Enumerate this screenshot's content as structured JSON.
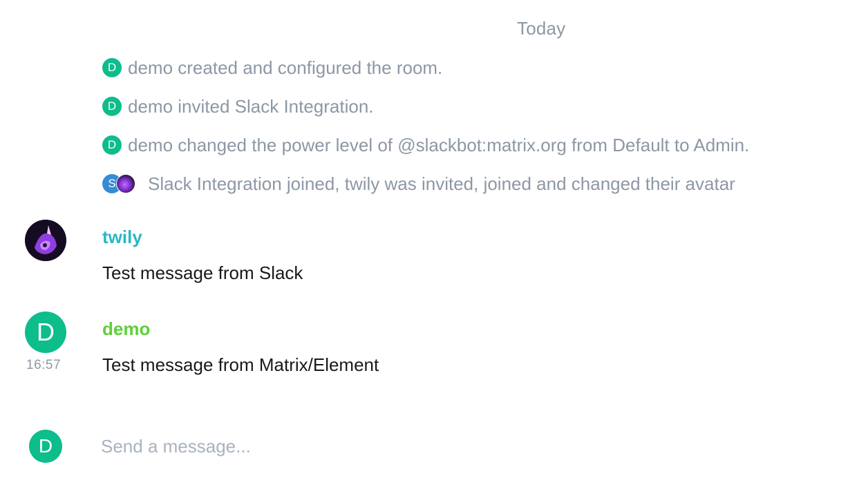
{
  "timeline": {
    "date_separator": "Today",
    "events": [
      {
        "avatar_initial": "D",
        "text": "demo created and configured the room."
      },
      {
        "avatar_initial": "D",
        "text": "demo invited Slack Integration."
      },
      {
        "avatar_initial": "D",
        "text": "demo changed the power level of @slackbot:matrix.org from Default to Admin."
      },
      {
        "avatar_initial": "S",
        "text": "Slack Integration joined, twily was invited, joined and changed their avatar"
      }
    ],
    "messages": [
      {
        "sender": "twily",
        "sender_color": "#2ab7c4",
        "body": "Test message from Slack",
        "timestamp": ""
      },
      {
        "sender": "demo",
        "sender_color": "#5fcf3a",
        "avatar_initial": "D",
        "body": "Test message from Matrix/Element",
        "timestamp": "16:57"
      }
    ]
  },
  "composer": {
    "avatar_initial": "D",
    "placeholder": "Send a message..."
  },
  "colors": {
    "accent": "#0dbd8b",
    "muted_text": "#8d97a5"
  }
}
